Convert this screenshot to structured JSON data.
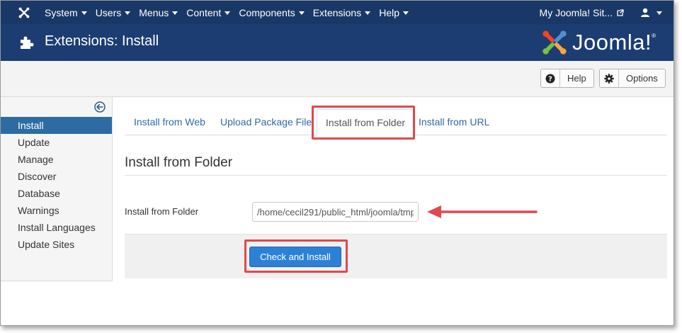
{
  "topbar": {
    "menu": [
      {
        "label": "System"
      },
      {
        "label": "Users"
      },
      {
        "label": "Menus"
      },
      {
        "label": "Content"
      },
      {
        "label": "Components"
      },
      {
        "label": "Extensions"
      },
      {
        "label": "Help"
      }
    ],
    "site_link": "My Joomla! Sit...",
    "icons": {
      "logo": "joomla-logo-icon",
      "external": "external-link-icon",
      "user": "user-icon"
    }
  },
  "header": {
    "title": "Extensions: Install",
    "brand": "Joomla!",
    "brand_text": "Joomla",
    "brand_reg": "®"
  },
  "toolbar": {
    "help_label": "Help",
    "options_label": "Options"
  },
  "sidebar": {
    "items": [
      {
        "label": "Install",
        "active": true
      },
      {
        "label": "Update"
      },
      {
        "label": "Manage"
      },
      {
        "label": "Discover"
      },
      {
        "label": "Database"
      },
      {
        "label": "Warnings"
      },
      {
        "label": "Install Languages"
      },
      {
        "label": "Update Sites"
      }
    ]
  },
  "tabs": [
    {
      "label": "Install from Web"
    },
    {
      "label": "Upload Package File"
    },
    {
      "label": "Install from Folder",
      "active": true
    },
    {
      "label": "Install from URL"
    }
  ],
  "main": {
    "section_title": "Install from Folder",
    "field_label": "Install from Folder",
    "folder_value": "/home/cecil291/public_html/joomla/tmp",
    "button_label": "Check and Install"
  },
  "colors": {
    "topbar": "#1a3867",
    "header": "#1c3d72",
    "active_sidebar": "#2d6ca2",
    "link": "#2f6aa8",
    "primary_button": "#2c81d6",
    "annotation_red": "#e0484d"
  }
}
